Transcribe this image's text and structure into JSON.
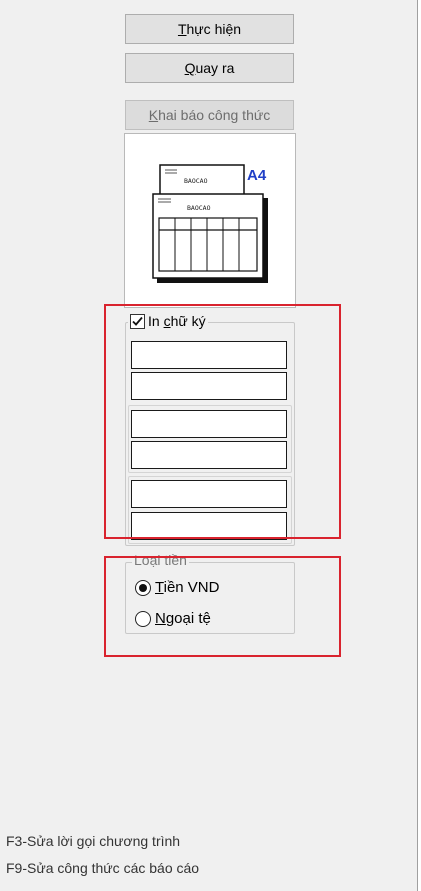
{
  "buttons": {
    "execute": {
      "pre": "",
      "ul": "T",
      "post": "hực hiện"
    },
    "back": {
      "pre": "",
      "ul": "Q",
      "post": "uay ra"
    },
    "formula": {
      "pre": "",
      "ul": "K",
      "post": "hai báo công thức"
    }
  },
  "preview": {
    "paper_size": "A4",
    "sheet_title": "BAOCAO"
  },
  "signature": {
    "checked": true,
    "label_pre": "In ",
    "label_ul": "c",
    "label_post": "hữ ký",
    "fields": [
      "",
      "",
      "",
      "",
      "",
      ""
    ]
  },
  "currency": {
    "legend": "Loại tiền",
    "options": [
      {
        "pre": "",
        "ul": "T",
        "post": "iền VND",
        "selected": true
      },
      {
        "pre": "",
        "ul": "N",
        "post": "goại tệ",
        "selected": false
      }
    ]
  },
  "footer": {
    "line1": "F3-Sửa lời gọi chương trình",
    "line2": "F9-Sửa công thức các báo cáo"
  },
  "colors": {
    "highlight": "#d9232e",
    "panel": "#f0f0f0",
    "a4": "#1f3fc7"
  }
}
